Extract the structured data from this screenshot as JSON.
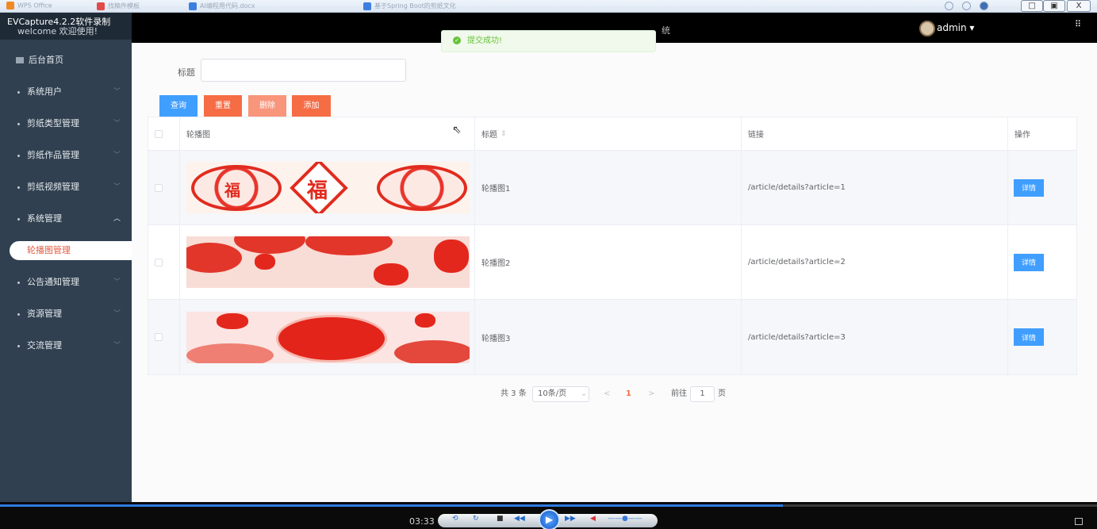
{
  "os": {
    "tabs": [
      "WPS Office",
      "找稿件模板",
      "AI编程用代码.docx",
      "基于Spring Boot的剪纸文化"
    ],
    "controls": [
      "□",
      "▣",
      "X"
    ]
  },
  "sidebar": {
    "brand_line1": "EVCapture4.2.2软件录制",
    "brand_line2": "welcome 欢迎使用!",
    "items": [
      {
        "label": "后台首页"
      },
      {
        "label": "系统用户"
      },
      {
        "label": "剪纸类型管理"
      },
      {
        "label": "剪纸作品管理"
      },
      {
        "label": "剪纸视频管理"
      },
      {
        "label": "系统管理"
      },
      {
        "label": "公告通知管理"
      },
      {
        "label": "资源管理"
      },
      {
        "label": "交流管理"
      }
    ],
    "active_sub": "轮播图管理"
  },
  "header": {
    "title_fragment": "统",
    "user": "admin ▾",
    "expand_icon": "⠿"
  },
  "toast": {
    "message": "提交成功!"
  },
  "search": {
    "label": "标题",
    "value": "",
    "placeholder": ""
  },
  "toolbar": {
    "query": "查询",
    "reset": "重置",
    "delete": "删除",
    "add": "添加"
  },
  "table": {
    "columns": [
      "轮播图",
      "标题",
      "链接",
      "操作"
    ],
    "sort_icon": "⇕",
    "rows": [
      {
        "title": "轮播图1",
        "link": "/article/details?article=1",
        "action": "详情"
      },
      {
        "title": "轮播图2",
        "link": "/article/details?article=2",
        "action": "详情"
      },
      {
        "title": "轮播图3",
        "link": "/article/details?article=3",
        "action": "详情"
      }
    ]
  },
  "pagination": {
    "total": "共 3 条",
    "page_size": "10条/页",
    "prev": "<",
    "current": "1",
    "next": ">",
    "goto": "前往",
    "goto_value": "1",
    "page_unit": "页"
  },
  "player": {
    "time": "03:33",
    "progress": 0.714
  },
  "colors": {
    "primary": "#409eff",
    "danger": "#f56c45",
    "sidebar": "#304050",
    "success": "#67c23a"
  }
}
